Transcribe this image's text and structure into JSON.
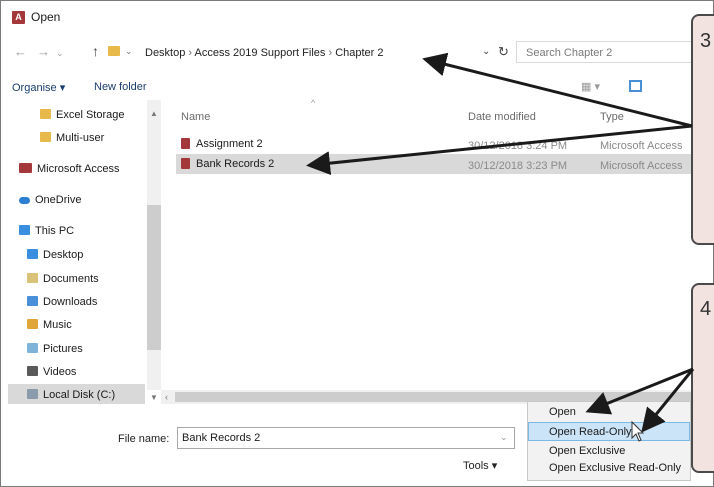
{
  "window": {
    "title": "Open",
    "app_icon": "A"
  },
  "nav": {
    "breadcrumb": [
      "Desktop",
      "Access 2019 Support Files",
      "Chapter 2"
    ],
    "search_placeholder": "Search Chapter 2"
  },
  "toolbar": {
    "organise": "Organise",
    "new_folder": "New folder"
  },
  "sidebar": {
    "items": [
      {
        "label": "Excel Storage",
        "icon": "folder-icon"
      },
      {
        "label": "Multi-user",
        "icon": "folder-icon"
      },
      {
        "label": "Microsoft Access",
        "icon": "access-icon"
      },
      {
        "label": "OneDrive",
        "icon": "cloud-icon"
      },
      {
        "label": "This PC",
        "icon": "computer-icon"
      },
      {
        "label": "Desktop",
        "icon": "desktop-icon"
      },
      {
        "label": "Documents",
        "icon": "documents-icon"
      },
      {
        "label": "Downloads",
        "icon": "downloads-icon"
      },
      {
        "label": "Music",
        "icon": "music-icon"
      },
      {
        "label": "Pictures",
        "icon": "pictures-icon"
      },
      {
        "label": "Videos",
        "icon": "videos-icon"
      },
      {
        "label": "Local Disk (C:)",
        "icon": "disk-icon"
      }
    ]
  },
  "columns": {
    "name": "Name",
    "date": "Date modified",
    "type": "Type"
  },
  "files": [
    {
      "name": "Assignment 2",
      "date": "30/12/2018 3:24 PM",
      "type": "Microsoft Access"
    },
    {
      "name": "Bank Records 2",
      "date": "30/12/2018 3:23 PM",
      "type": "Microsoft Access"
    }
  ],
  "bottom": {
    "filename_label": "File name:",
    "filename_value": "Bank Records 2",
    "tools_label": "Tools"
  },
  "open_menu": [
    "Open",
    "Open Read-Only",
    "Open Exclusive",
    "Open Exclusive Read-Only"
  ],
  "callouts": {
    "step_top": "3",
    "step_bottom": "4"
  },
  "colors": {
    "access_red": "#a4373a",
    "menu_highlight": "#cce4f7",
    "callout_bg": "#f3e3e0"
  }
}
